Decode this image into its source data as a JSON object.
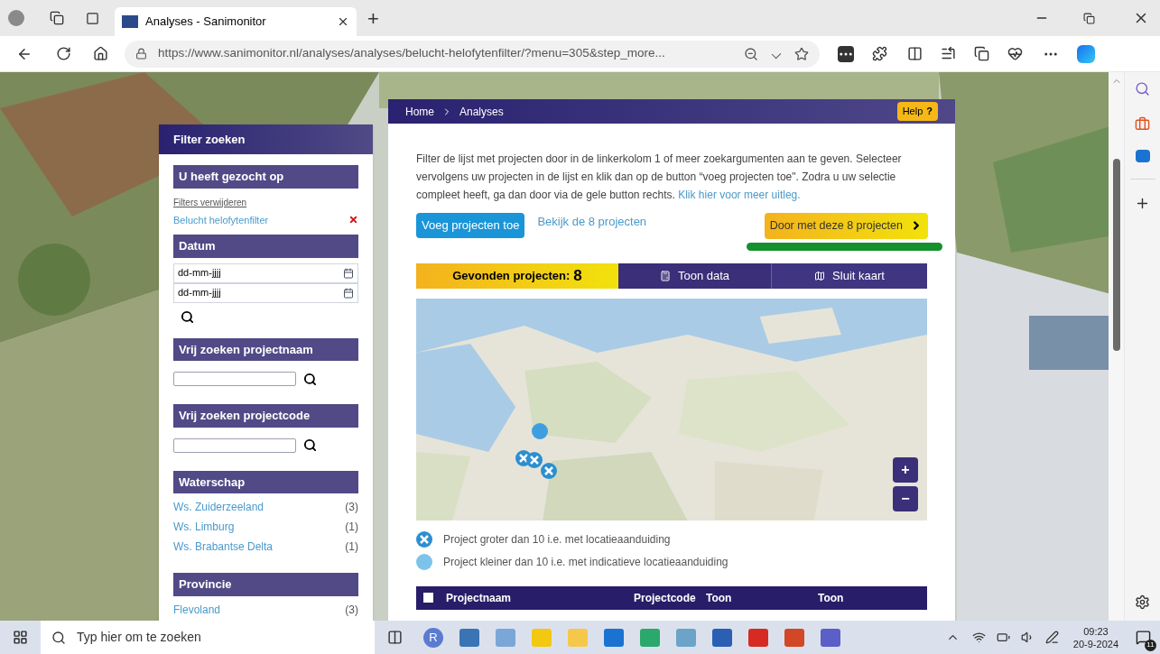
{
  "browser": {
    "tab_title": "Analyses - Sanimonitor",
    "new_tab": "+",
    "url": "https://www.sanimonitor.nl/analyses/analyses/belucht-helofytenfilter/?menu=305&step_more..."
  },
  "breadcrumb": [
    "Home",
    "Analyses"
  ],
  "help": {
    "label": "Help",
    "icon": "?"
  },
  "sidebar": {
    "title": "Filter zoeken",
    "sections": [
      {
        "kind": "searched",
        "title": "U heeft gezocht op",
        "clear": "Filters verwijderen",
        "filters": [
          "Belucht helofytenfilter"
        ]
      },
      {
        "kind": "date",
        "title": "Datum",
        "placeholders": [
          "dd-mm-jjjj",
          "dd-mm-jjjj"
        ]
      },
      {
        "kind": "text",
        "title": "Vrij zoeken projectnaam"
      },
      {
        "kind": "text",
        "title": "Vrij zoeken projectcode"
      },
      {
        "kind": "facet",
        "title": "Waterschap",
        "items": [
          {
            "label": "Ws. Zuiderzeeland",
            "count": "(3)"
          },
          {
            "label": "Ws. Limburg",
            "count": "(1)"
          },
          {
            "label": "Ws. Brabantse Delta",
            "count": "(1)"
          }
        ]
      },
      {
        "kind": "facet",
        "title": "Provincie",
        "items": [
          {
            "label": "Flevoland",
            "count": "(3)"
          }
        ]
      }
    ]
  },
  "intro": {
    "text": "Filter de lijst met projecten door in de linkerkolom 1 of meer zoekargumenten aan te geven. Selecteer vervolgens uw projecten in de lijst en klik dan op de button “voeg projecten toe\". Zodra u uw selectie compleet heeft, ga dan door via de gele button rechts.",
    "link": "Klik hier voor meer uitleg."
  },
  "actions": {
    "add": "Voeg projecten toe",
    "view": "Bekijk de 8 projecten",
    "next": "Door met deze 8 projecten"
  },
  "tabs": [
    {
      "kind": "count",
      "label": "Gevonden projecten:",
      "count": "8"
    },
    {
      "kind": "data",
      "label": "Toon data"
    },
    {
      "kind": "map",
      "label": "Sluit kaart"
    }
  ],
  "map": {
    "zoom_in": "+",
    "zoom_out": "−"
  },
  "legend": [
    {
      "kind": "large",
      "label": "Project groter dan 10 i.e. met locatieaanduiding"
    },
    {
      "kind": "small",
      "label": "Project kleiner dan 10 i.e. met indicatieve locatieaanduiding"
    }
  ],
  "table": {
    "select_all": {
      "checked": false
    },
    "columns": [
      "Projectnaam",
      "Projectcode",
      "Toon",
      "Toon"
    ]
  },
  "taskbar": {
    "search_placeholder": "Typ hier om te zoeken",
    "avatar": "R",
    "time": "09:23",
    "date": "20-9-2024",
    "notifications": "11"
  }
}
